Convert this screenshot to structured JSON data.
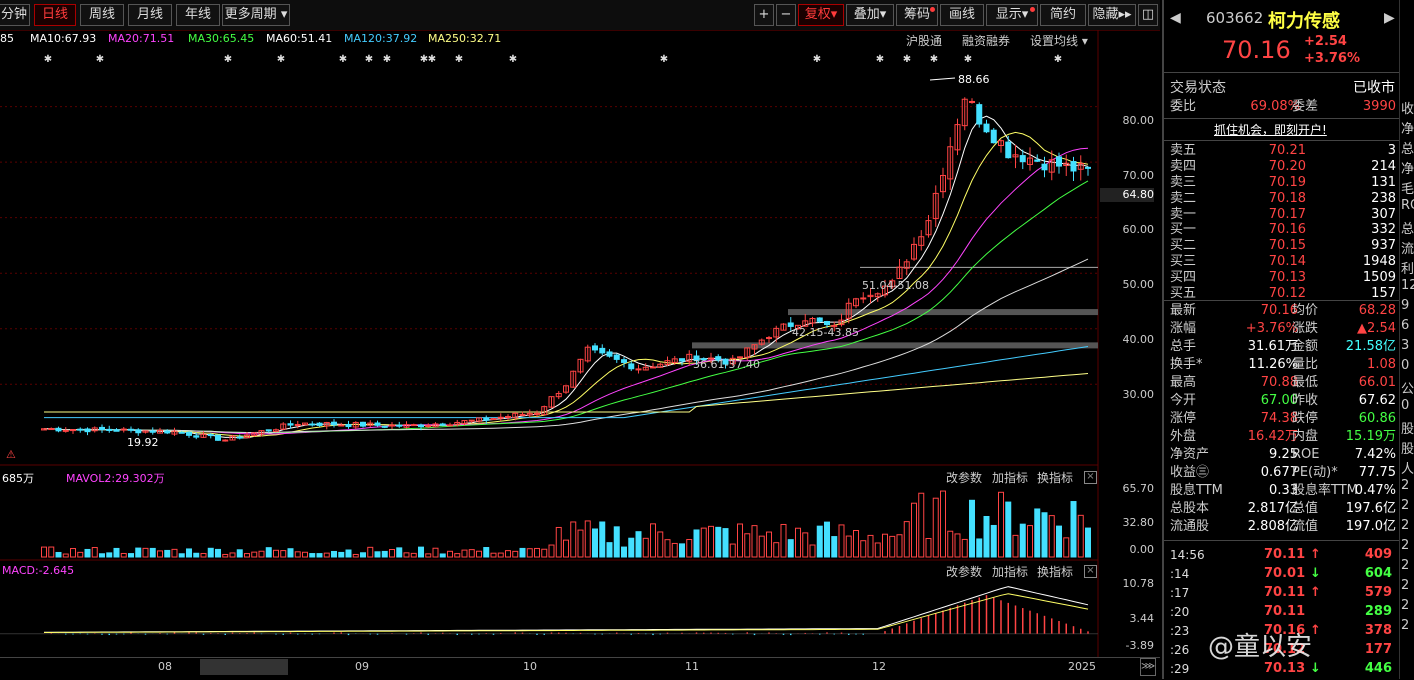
{
  "toolbar": {
    "cut_tab": "分钟",
    "tabs": [
      "日线",
      "周线",
      "月线",
      "年线",
      "更多周期"
    ],
    "right_buttons": [
      "复权",
      "叠加",
      "筹码",
      "画线",
      "显示",
      "简约",
      "隐藏"
    ],
    "plus": "+",
    "minus": "−"
  },
  "ma_legend": [
    {
      "text": "85",
      "color": "#ffffff"
    },
    {
      "text": "MA10:67.93",
      "color": "#ffffff"
    },
    {
      "text": "MA20:71.51",
      "color": "#ff44ff"
    },
    {
      "text": "MA30:65.45",
      "color": "#44ff44"
    },
    {
      "text": "MA60:51.41",
      "color": "#ffffff"
    },
    {
      "text": "MA120:37.92",
      "color": "#44ccff"
    },
    {
      "text": "MA250:32.71",
      "color": "#ffff88"
    }
  ],
  "top_menus": [
    "沪股通",
    "融资融券",
    "设置均线"
  ],
  "price_axis": [
    "80.00",
    "70.00",
    "64.80",
    "60.00",
    "50.00",
    "40.00",
    "30.00"
  ],
  "annotations": {
    "high": "88.66",
    "low": "19.92",
    "level1": "51.04-51.08",
    "level2": "42.15-43.85",
    "level3": "36.61-37.40"
  },
  "volume": {
    "legend_left": "685万",
    "legend_mavol": "MAVOL2:29.302万",
    "axis": [
      "65.70",
      "32.80",
      "0.00"
    ],
    "buttons": [
      "改参数",
      "加指标",
      "换指标"
    ]
  },
  "macd": {
    "legend": "MACD:-2.645",
    "axis": [
      "10.78",
      "3.44",
      "-3.89"
    ],
    "buttons": [
      "改参数",
      "加指标",
      "换指标"
    ]
  },
  "x_axis": [
    "08",
    "09",
    "10",
    "11",
    "12",
    "2025"
  ],
  "stock": {
    "code": "603662",
    "name": "柯力传感",
    "price": "70.16",
    "change": "+2.54",
    "change_pct": "+3.76%",
    "status_label": "交易状态",
    "status_value": "已收市",
    "webi_label": "委比",
    "webi_value": "69.08%",
    "weicha_label": "委差",
    "weicha_value": "3990",
    "banner": "抓住机会，即刻开户!"
  },
  "order_book": {
    "asks": [
      {
        "label": "卖五",
        "price": "70.21",
        "vol": "3"
      },
      {
        "label": "卖四",
        "price": "70.20",
        "vol": "214"
      },
      {
        "label": "卖三",
        "price": "70.19",
        "vol": "131"
      },
      {
        "label": "卖二",
        "price": "70.18",
        "vol": "238"
      },
      {
        "label": "卖一",
        "price": "70.17",
        "vol": "307"
      }
    ],
    "bids": [
      {
        "label": "买一",
        "price": "70.16",
        "vol": "332"
      },
      {
        "label": "买二",
        "price": "70.15",
        "vol": "937"
      },
      {
        "label": "买三",
        "price": "70.14",
        "vol": "1948"
      },
      {
        "label": "买四",
        "price": "70.13",
        "vol": "1509"
      },
      {
        "label": "买五",
        "price": "70.12",
        "vol": "157"
      }
    ]
  },
  "stats": [
    {
      "k": "最新",
      "v": "70.16",
      "k2": "均价",
      "v2": "68.28",
      "c2": "#ff4444"
    },
    {
      "k": "涨幅",
      "v": "+3.76%",
      "k2": "涨跌",
      "v2": "▲2.54",
      "c2": "#ff4444"
    },
    {
      "k": "总手",
      "v": "31.61万",
      "k2": "金额",
      "v2": "21.58亿",
      "c1": "#ffffff",
      "c2": "#44ffff"
    },
    {
      "k": "换手*",
      "v": "11.26%",
      "k2": "量比",
      "v2": "1.08",
      "c1": "#ffffff",
      "c2": "#ff4444"
    },
    {
      "k": "最高",
      "v": "70.88",
      "k2": "最低",
      "v2": "66.01",
      "c2": "#ff4444"
    },
    {
      "k": "今开",
      "v": "67.00",
      "k2": "昨收",
      "v2": "67.62",
      "c1": "#44ff44",
      "c2": "#ffffff"
    },
    {
      "k": "涨停",
      "v": "74.38",
      "k2": "跌停",
      "v2": "60.86",
      "c2": "#44ff44"
    },
    {
      "k": "外盘",
      "v": "16.42万",
      "k2": "内盘",
      "v2": "15.19万",
      "c2": "#44ff44"
    },
    {
      "k": "净资产",
      "v": "9.25",
      "k2": "ROE",
      "v2": "7.42%",
      "c1": "#ffffff",
      "c2": "#ffffff"
    },
    {
      "k": "收益㊂",
      "v": "0.677",
      "k2": "PE(动)*",
      "v2": "77.75",
      "c1": "#ffffff",
      "c2": "#ffffff"
    },
    {
      "k": "股息TTM",
      "v": "0.33",
      "k2": "股息率TTM",
      "v2": "0.47%",
      "c1": "#ffffff",
      "c2": "#ffffff"
    },
    {
      "k": "总股本",
      "v": "2.817亿",
      "k2": "总值",
      "v2": "197.6亿",
      "c1": "#ffffff",
      "c2": "#ffffff"
    },
    {
      "k": "流通股",
      "v": "2.808亿",
      "k2": "流值",
      "v2": "197.0亿",
      "c1": "#ffffff",
      "c2": "#ffffff"
    }
  ],
  "ticks": [
    {
      "t": "14:56",
      "p": "70.11",
      "a": "↑",
      "q": "409",
      "c": "#ff4444"
    },
    {
      "t": ":14",
      "p": "70.01",
      "a": "↓",
      "q": "604",
      "c": "#44ff44"
    },
    {
      "t": ":17",
      "p": "70.11",
      "a": "↑",
      "q": "579",
      "c": "#ff4444"
    },
    {
      "t": ":20",
      "p": "70.11",
      "a": "",
      "q": "289",
      "c": "#44ff44"
    },
    {
      "t": ":23",
      "p": "70.16",
      "a": "↑",
      "q": "378",
      "c": "#ff4444"
    },
    {
      "t": ":26",
      "p": "70.12",
      "a": "",
      "q": "177",
      "c": "#ff4444"
    },
    {
      "t": ":29",
      "p": "70.13",
      "a": "↓",
      "q": "446",
      "c": "#44ff44"
    }
  ],
  "watermark": "@童以安",
  "edge_text": [
    "收",
    "净",
    "总",
    "净",
    "毛",
    "RO",
    "总",
    "流",
    "利",
    "12",
    "9",
    "6",
    "3",
    "0",
    "公",
    "0",
    "股",
    "股",
    "人",
    "2",
    "2",
    "2",
    "2",
    "2",
    "2",
    "2",
    "2"
  ],
  "chart_data": {
    "type": "candlestick",
    "y_range": [
      16,
      92
    ],
    "price_axis_ticks": [
      30,
      40,
      50,
      60,
      70,
      80
    ],
    "x_labels": [
      "08",
      "09",
      "10",
      "11",
      "12",
      "2025"
    ],
    "note_levels": [
      {
        "label": "51.04-51.08",
        "value": 51.06
      },
      {
        "label": "42.15-43.85",
        "value": 43.0
      },
      {
        "label": "36.61-37.40",
        "value": 37.0
      }
    ],
    "high_marker": 88.66,
    "low_marker": 19.92,
    "current_price": 64.8,
    "volume_range": [
      0,
      65.7
    ],
    "macd_range": [
      -3.89,
      10.78
    ]
  }
}
